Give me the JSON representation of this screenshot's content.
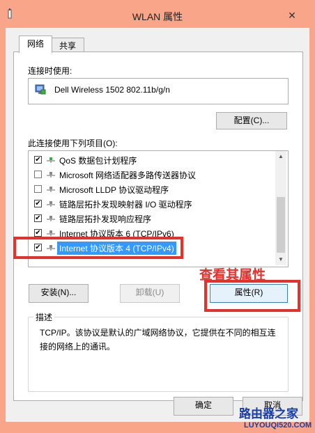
{
  "window": {
    "title": "WLAN 属性"
  },
  "tabs": [
    {
      "label": "网络",
      "active": true
    },
    {
      "label": "共享",
      "active": false
    }
  ],
  "connect_using": {
    "label": "连接时使用:",
    "adapter": "Dell Wireless 1502 802.11b/g/n",
    "configure_button": "配置(C)..."
  },
  "items": {
    "label": "此连接使用下列项目(O):",
    "list": [
      {
        "label": "QoS 数据包计划程序",
        "checked": true,
        "selected": false
      },
      {
        "label": "Microsoft 网络适配器多路传送器协议",
        "checked": false,
        "selected": false
      },
      {
        "label": "Microsoft LLDP 协议驱动程序",
        "checked": false,
        "selected": false
      },
      {
        "label": "链路层拓扑发现映射器 I/O 驱动程序",
        "checked": true,
        "selected": false
      },
      {
        "label": "链路层拓扑发现响应程序",
        "checked": true,
        "selected": false
      },
      {
        "label": "Internet 协议版本 6 (TCP/IPv6)",
        "checked": true,
        "selected": false
      },
      {
        "label": "Internet 协议版本 4 (TCP/IPv4)",
        "checked": true,
        "selected": true
      }
    ]
  },
  "buttons": {
    "install": "安装(N)...",
    "uninstall": "卸载(U)",
    "properties": "属性(R)",
    "ok": "确定",
    "cancel": "取消"
  },
  "description": {
    "title": "描述",
    "text": "TCP/IP。该协议是默认的广域网络协议，它提供在不同的相互连接的网络上的通讯。"
  },
  "annotation": {
    "text": "查看其属性",
    "color": "#e5312c"
  },
  "watermark": {
    "logo": "路由器之家",
    "url": "LUYOUQI520.COM"
  },
  "colors": {
    "frame": "#f8a58a",
    "selection": "#3399ff",
    "annotation": "#e5312c"
  }
}
